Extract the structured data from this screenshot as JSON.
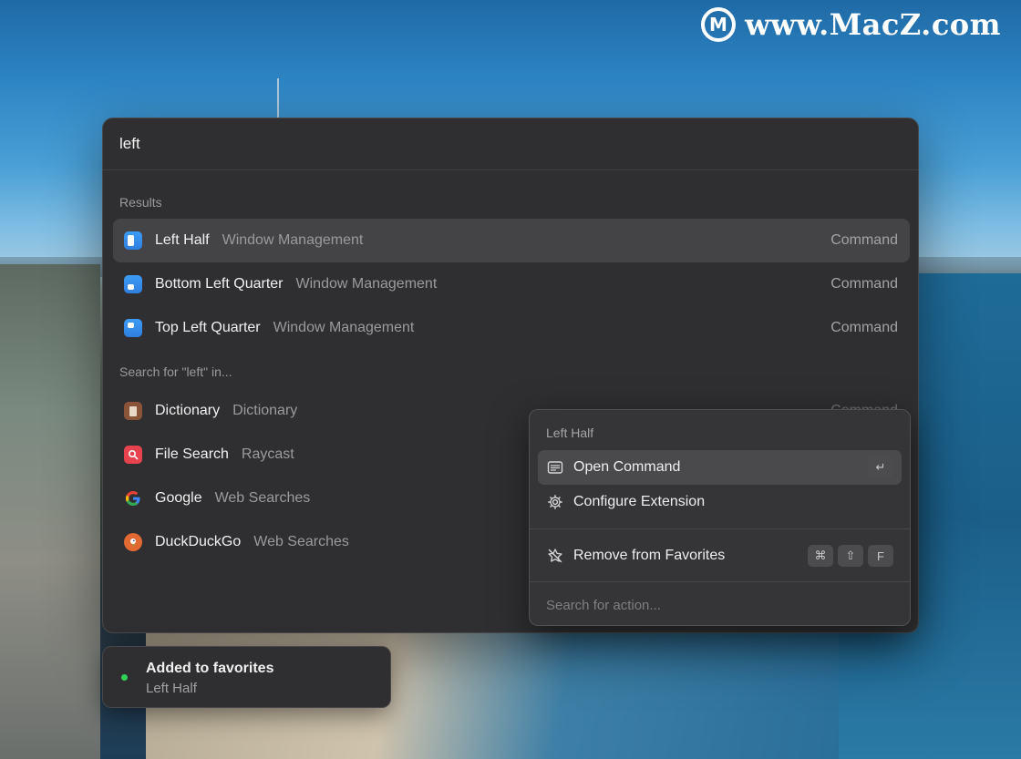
{
  "watermark": {
    "logo_letter": "M",
    "text": "www.MacZ.com"
  },
  "search": {
    "value": "left"
  },
  "sections": {
    "results": "Results",
    "search_for": "Search for \"left\" in..."
  },
  "results": [
    {
      "title": "Left Half",
      "subtitle": "Window Management",
      "accessory": "Command",
      "icon": "window-left-half-icon"
    },
    {
      "title": "Bottom Left Quarter",
      "subtitle": "Window Management",
      "accessory": "Command",
      "icon": "window-bottom-left-icon"
    },
    {
      "title": "Top Left Quarter",
      "subtitle": "Window Management",
      "accessory": "Command",
      "icon": "window-top-left-icon"
    }
  ],
  "search_in": [
    {
      "title": "Dictionary",
      "subtitle": "Dictionary",
      "accessory": "Command",
      "icon": "dictionary-icon"
    },
    {
      "title": "File Search",
      "subtitle": "Raycast",
      "icon": "file-search-icon"
    },
    {
      "title": "Google",
      "subtitle": "Web Searches",
      "icon": "google-icon",
      "glyph": "G"
    },
    {
      "title": "DuckDuckGo",
      "subtitle": "Web Searches",
      "icon": "duckduckgo-icon"
    }
  ],
  "action_panel": {
    "title": "Left Half",
    "items": [
      {
        "label": "Open Command",
        "icon": "command-window-icon",
        "shortcut": [
          "↵"
        ]
      },
      {
        "label": "Configure Extension",
        "icon": "gear-icon"
      },
      {
        "label": "Remove from Favorites",
        "icon": "star-slash-icon",
        "shortcut": [
          "⌘",
          "⇧",
          "F"
        ]
      }
    ],
    "search_placeholder": "Search for action..."
  },
  "toast": {
    "title": "Added to favorites",
    "subtitle": "Left Half",
    "status_color": "#30d158"
  },
  "colors": {
    "window_bg": "#2f2f31",
    "selected_row": "#444446",
    "accent_blue": "#3d9cf4"
  }
}
